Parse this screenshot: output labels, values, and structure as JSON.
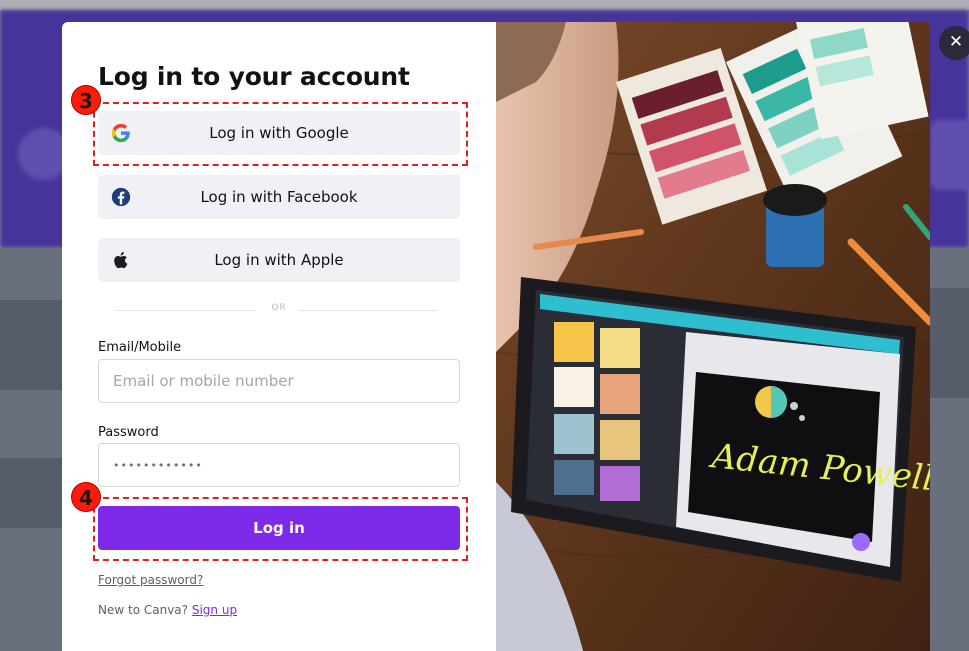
{
  "modal": {
    "title": "Log in to your account",
    "sso_buttons": [
      {
        "label": "Log in with Google",
        "icon": "google-icon"
      },
      {
        "label": "Log in with Facebook",
        "icon": "facebook-icon"
      },
      {
        "label": "Log in with Apple",
        "icon": "apple-icon"
      }
    ],
    "divider_text": "OR",
    "email": {
      "label": "Email/Mobile",
      "placeholder": "Email or mobile number"
    },
    "password": {
      "label": "Password",
      "value": "••••••••••••"
    },
    "login_label": "Log in",
    "forgot_label": "Forgot password?",
    "signup_prompt": "New to Canva?",
    "signup_label": "Sign up",
    "close_icon": "close-icon",
    "hero_image": {
      "signature_text": "Adam Powell"
    }
  },
  "annotations": [
    {
      "number": "3",
      "target": "google-login"
    },
    {
      "number": "4",
      "target": "login-button"
    }
  ],
  "colors": {
    "brand_purple": "#7d2ae8",
    "annotation_red": "#e02020",
    "button_gray": "#f0f1f5"
  }
}
